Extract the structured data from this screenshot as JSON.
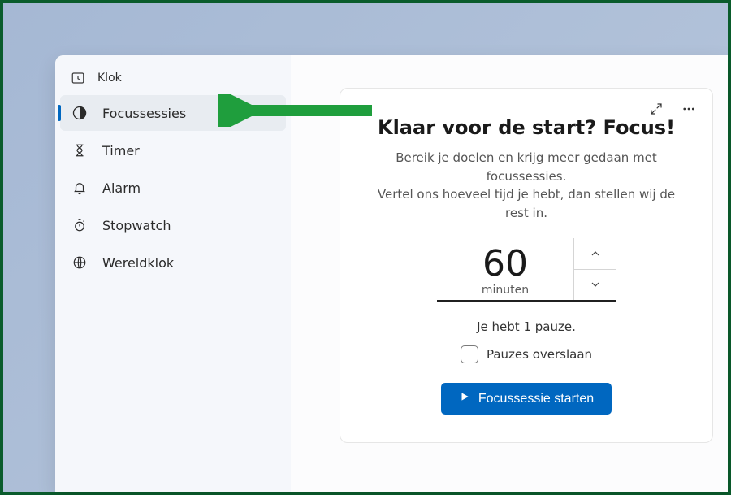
{
  "app": {
    "title": "Klok"
  },
  "sidebar": {
    "items": [
      {
        "label": "Focussessies"
      },
      {
        "label": "Timer"
      },
      {
        "label": "Alarm"
      },
      {
        "label": "Stopwatch"
      },
      {
        "label": "Wereldklok"
      }
    ]
  },
  "focus": {
    "headline": "Klaar voor de start? Focus!",
    "subtext_line1": "Bereik je doelen en krijg meer gedaan met focussessies.",
    "subtext_line2": "Vertel ons hoeveel tijd je hebt, dan stellen wij de rest in.",
    "duration_value": "60",
    "duration_unit": "minuten",
    "break_info": "Je hebt 1 pauze.",
    "skip_breaks_label": "Pauzes overslaan",
    "start_button_label": "Focussessie starten"
  }
}
